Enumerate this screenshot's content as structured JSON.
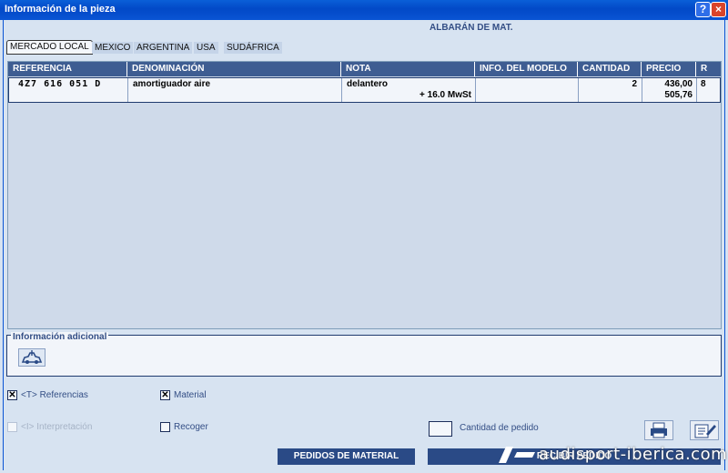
{
  "window": {
    "title": "Información de la pieza",
    "help_label": "?",
    "close_label": "×"
  },
  "document_title": "ALBARÁN DE MAT.",
  "tabs": [
    "MERCADO LOCAL",
    "MEXICO",
    "ARGENTINA",
    "USA",
    "SUDÁFRICA"
  ],
  "table": {
    "headers": [
      "REFERENCIA",
      "DENOMINACIÓN",
      "NOTA",
      "INFO. DEL MODELO",
      "CANTIDAD",
      "PRECIO",
      "R"
    ],
    "rows": [
      {
        "referencia": "4Z7 616 051 D",
        "denominacion": "amortiguador aire",
        "nota": "delantero",
        "nota_extra": "+ 16.0 MwSt",
        "info_modelo": "",
        "cantidad": "2",
        "precio": "436,00",
        "precio_total": "505,76",
        "r": "8"
      }
    ]
  },
  "additional_info": {
    "label": "Información adicional",
    "icon": "car-info-icon"
  },
  "options": {
    "referencias": {
      "label": "<T> Referencias",
      "checked": true,
      "check_mark": "✕"
    },
    "material": {
      "label": "Material",
      "checked": true,
      "check_mark": "✕"
    },
    "interpretacion": {
      "label": "<I> Interpretación",
      "checked": false,
      "disabled": true
    },
    "recoger": {
      "label": "Recoger",
      "checked": false
    }
  },
  "quantity": {
    "label": "Cantidad de pedido",
    "value": ""
  },
  "toolbar_icons": [
    "printer-icon",
    "edit-notepad-icon"
  ],
  "buttons": {
    "pedidos": "PEDIDOS DE MATERIAL",
    "recibir": "RECIBIR PEDIDO"
  },
  "watermark": "audisport-iberica.com",
  "colors": {
    "header": "#3e5d92",
    "button": "#2a4a86",
    "titlebar": "#0a54d4"
  }
}
